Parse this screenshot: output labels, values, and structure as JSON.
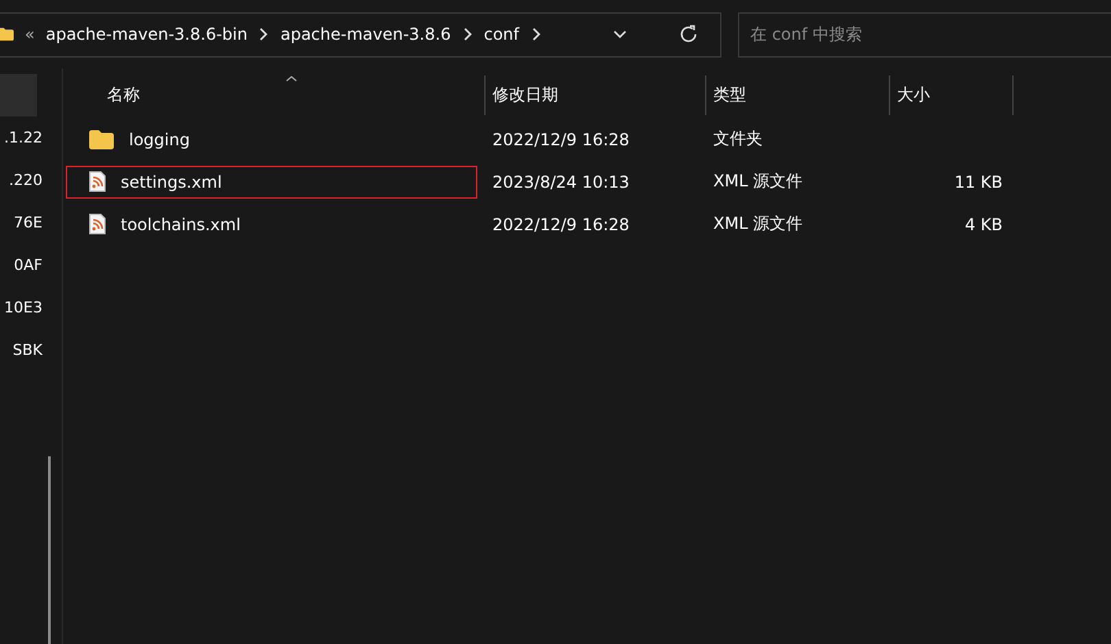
{
  "address_bar": {
    "overflow": "«",
    "crumbs": [
      "apache-maven-3.8.6-bin",
      "apache-maven-3.8.6",
      "conf"
    ]
  },
  "search": {
    "placeholder": "在 conf 中搜索"
  },
  "sidebar": {
    "items": [
      {
        "selected": true
      },
      {
        "label": ".1.22",
        "selected": false
      },
      {
        "label": ".220",
        "selected": false
      },
      {
        "label": "76E",
        "selected": false
      },
      {
        "label": "0AF",
        "selected": false
      },
      {
        "label": "10E3",
        "selected": false
      },
      {
        "label": "SBK",
        "selected": false
      }
    ]
  },
  "table": {
    "columns": [
      "名称",
      "修改日期",
      "类型",
      "大小"
    ],
    "rows": [
      {
        "kind": "folder",
        "name": "logging",
        "date": "2022/12/9 16:28",
        "type": "文件夹",
        "size": "",
        "outlined": false
      },
      {
        "kind": "xml",
        "name": "settings.xml",
        "date": "2023/8/24 10:13",
        "type": "XML 源文件",
        "size": "11 KB",
        "outlined": true
      },
      {
        "kind": "xml",
        "name": "toolchains.xml",
        "date": "2022/12/9 16:28",
        "type": "XML 源文件",
        "size": "4 KB",
        "outlined": false
      }
    ]
  }
}
